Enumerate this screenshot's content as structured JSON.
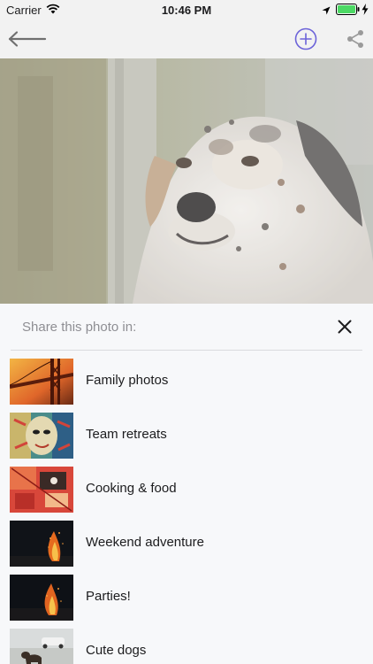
{
  "status_bar": {
    "carrier": "Carrier",
    "time": "10:46 PM",
    "icons": [
      "wifi-icon",
      "location-icon",
      "battery-icon",
      "charging-icon"
    ],
    "battery_color": "#4cd964"
  },
  "nav_bar": {
    "back_icon": "arrow-left-icon",
    "add_icon": "plus-circle-icon",
    "share_icon": "share-icon",
    "accent": "#6c63d9"
  },
  "share_sheet": {
    "title": "Share this photo in:",
    "close_icon": "close-icon",
    "albums": [
      {
        "name": "Family photos"
      },
      {
        "name": "Team retreats"
      },
      {
        "name": "Cooking & food"
      },
      {
        "name": "Weekend adventure"
      },
      {
        "name": "Parties!"
      },
      {
        "name": "Cute dogs"
      }
    ]
  }
}
